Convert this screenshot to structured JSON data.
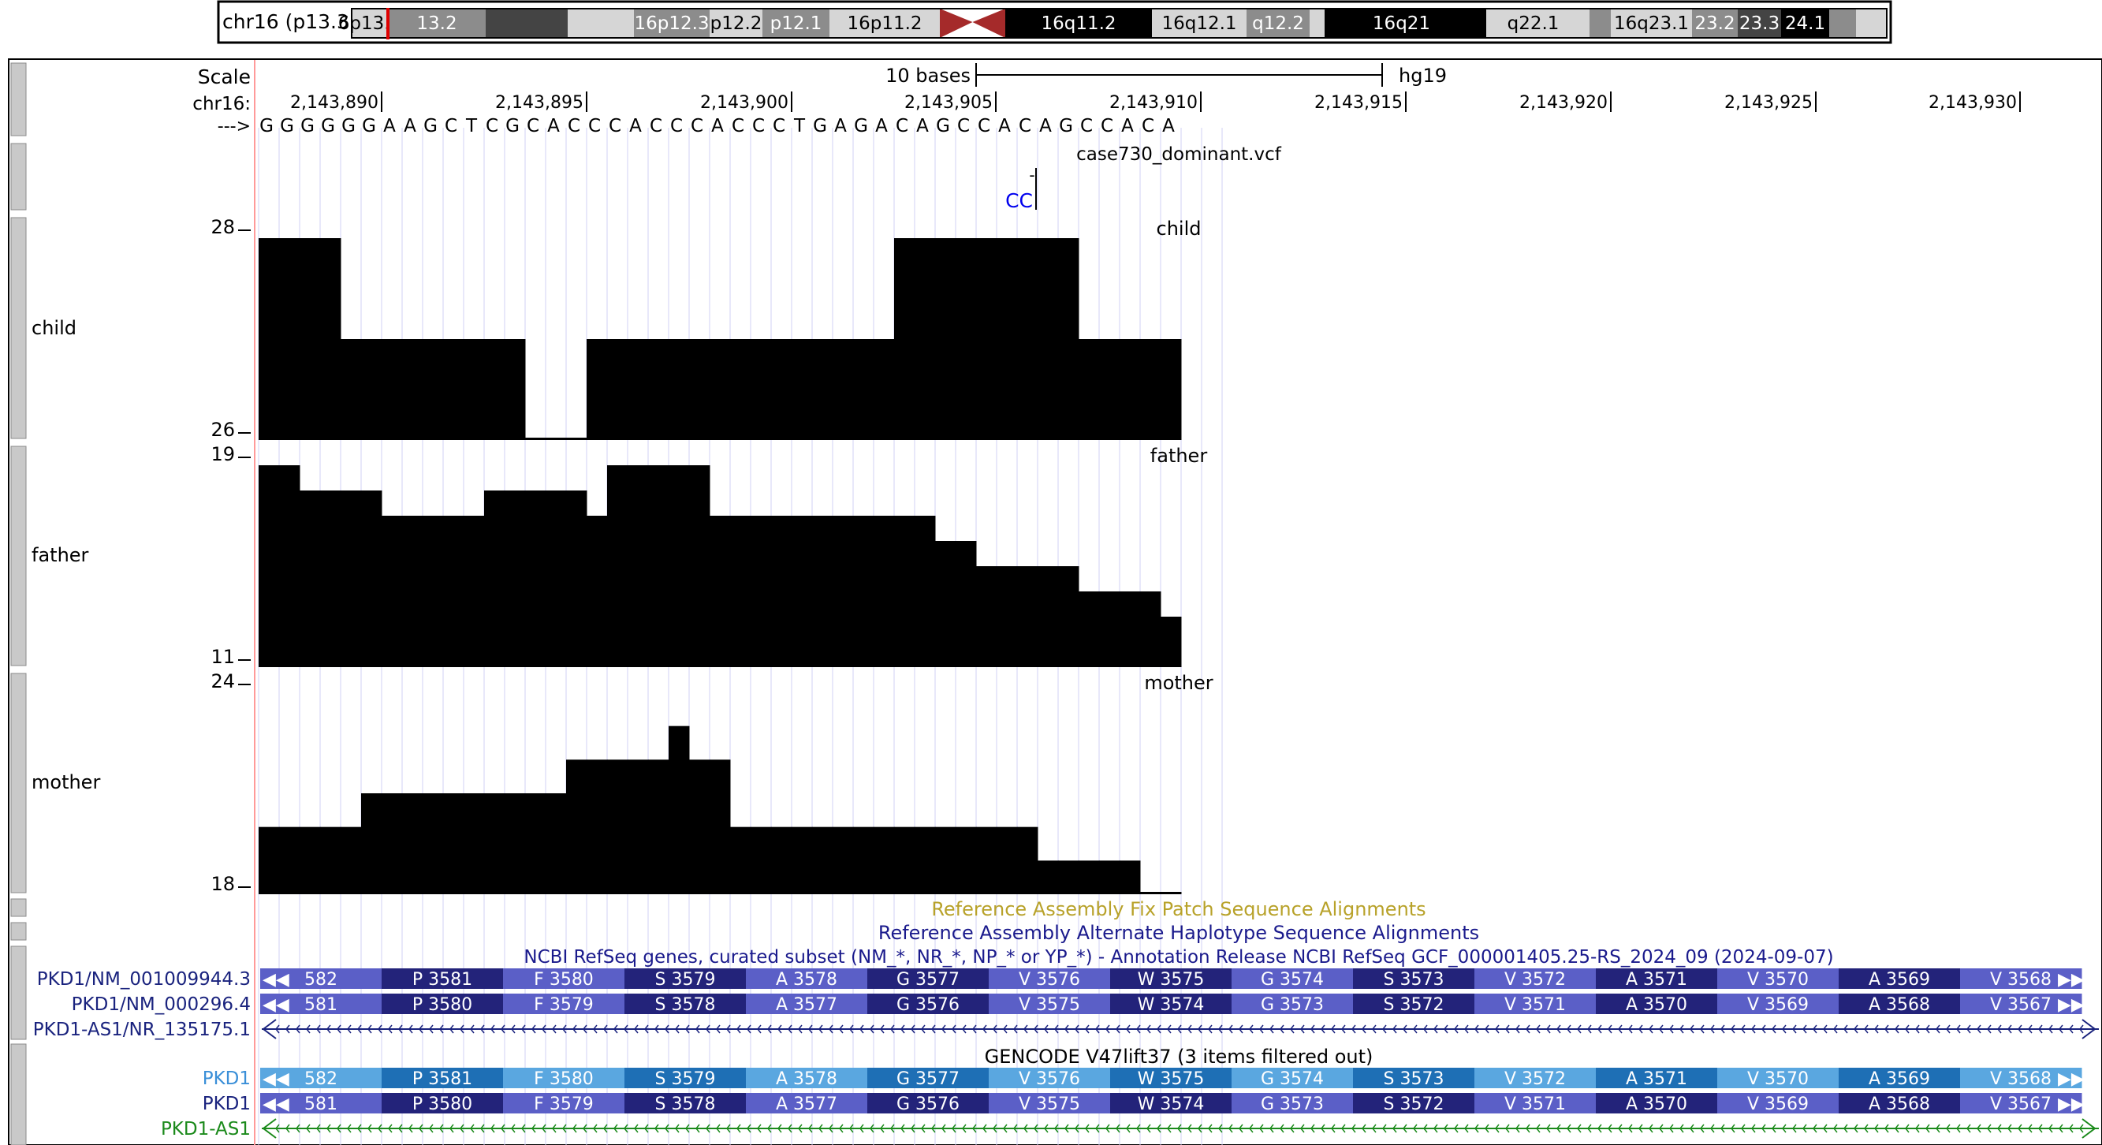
{
  "ideogram": {
    "label": "chr16 (p13.3)",
    "bands": [
      {
        "name": "6p13.3",
        "shade": "#d6d6d6",
        "text": "#000"
      },
      {
        "name": "13.2",
        "shade": "#8c8c8c",
        "text": "#fff"
      },
      {
        "name": "",
        "shade": "#444444",
        "text": "#fff"
      },
      {
        "name": "",
        "shade": "#d6d6d6",
        "text": "#000"
      },
      {
        "name": "16p12.3",
        "shade": "#8c8c8c",
        "text": "#fff"
      },
      {
        "name": "p12.2",
        "shade": "#d6d6d6",
        "text": "#000"
      },
      {
        "name": "p12.1",
        "shade": "#8c8c8c",
        "text": "#fff"
      },
      {
        "name": "16p11.2",
        "shade": "#d6d6d6",
        "text": "#000"
      },
      {
        "name": "",
        "shade": "centromere",
        "text": "#000"
      },
      {
        "name": "16q11.2",
        "shade": "#000000",
        "text": "#fff"
      },
      {
        "name": "16q12.1",
        "shade": "#d6d6d6",
        "text": "#000"
      },
      {
        "name": "q12.2",
        "shade": "#8c8c8c",
        "text": "#fff"
      },
      {
        "name": "",
        "shade": "#d6d6d6",
        "text": "#000"
      },
      {
        "name": "16q21",
        "shade": "#000000",
        "text": "#fff"
      },
      {
        "name": "",
        "shade": "#000000",
        "text": "#fff"
      },
      {
        "name": "q22.1",
        "shade": "#d6d6d6",
        "text": "#000"
      },
      {
        "name": "",
        "shade": "#d6d6d6",
        "text": "#000"
      },
      {
        "name": "",
        "shade": "#8c8c8c",
        "text": "#fff"
      },
      {
        "name": "16q23.1",
        "shade": "#d6d6d6",
        "text": "#000"
      },
      {
        "name": "23.2",
        "shade": "#8c8c8c",
        "text": "#fff"
      },
      {
        "name": "23.3",
        "shade": "#444444",
        "text": "#fff"
      },
      {
        "name": "24.1",
        "shade": "#000000",
        "text": "#fff"
      },
      {
        "name": "",
        "shade": "#8c8c8c",
        "text": "#fff"
      },
      {
        "name": "",
        "shade": "#d6d6d6",
        "text": "#000"
      }
    ]
  },
  "scale": {
    "label": "Scale",
    "bar": "10 bases",
    "assembly": "hg19"
  },
  "ruler": {
    "chrom": "chr16:",
    "positions": [
      "2,143,890",
      "2,143,895",
      "2,143,900",
      "2,143,905",
      "2,143,910",
      "2,143,915",
      "2,143,920",
      "2,143,925",
      "2,143,930"
    ]
  },
  "sequence": {
    "arrow": "--->",
    "bases": "GGGGGGAAGCTCGCACCCACCCACCCTGAGACAGCCACAGCCACA"
  },
  "vcf": {
    "title": "case730_dominant.vcf",
    "ref": "-",
    "alt": "CC"
  },
  "wiggles": [
    {
      "name": "child",
      "label": "child",
      "max": "28",
      "min": "26"
    },
    {
      "name": "father",
      "label": "father",
      "max": "19",
      "min": "11"
    },
    {
      "name": "mother",
      "label": "mother",
      "max": "24",
      "min": "18"
    }
  ],
  "coverage": {
    "child": [
      28,
      28,
      28,
      28,
      27,
      27,
      27,
      27,
      27,
      27,
      27,
      27,
      27,
      26,
      26,
      26,
      27,
      27,
      27,
      27,
      27,
      27,
      27,
      27,
      27,
      27,
      27,
      27,
      27,
      27,
      27,
      28,
      28,
      28,
      28,
      28,
      28,
      28,
      28,
      28,
      27,
      27,
      27,
      27,
      27
    ],
    "father": [
      19,
      19,
      18,
      18,
      18,
      18,
      17,
      17,
      17,
      17,
      17,
      18,
      18,
      18,
      18,
      18,
      17,
      19,
      19,
      19,
      19,
      19,
      17,
      17,
      17,
      17,
      17,
      17,
      17,
      17,
      17,
      17,
      17,
      16,
      16,
      15,
      15,
      15,
      15,
      15,
      14,
      14,
      14,
      14,
      13
    ],
    "mother": [
      20,
      20,
      20,
      20,
      20,
      21,
      21,
      21,
      21,
      21,
      21,
      21,
      21,
      21,
      21,
      22,
      22,
      22,
      22,
      22,
      23,
      22,
      22,
      20,
      20,
      20,
      20,
      20,
      20,
      20,
      20,
      20,
      20,
      20,
      20,
      20,
      20,
      20,
      19,
      19,
      19,
      19,
      19,
      18,
      18
    ]
  },
  "dense_titles": {
    "fix_patch": "Reference Assembly Fix Patch Sequence Alignments",
    "alt_haplo": "Reference Assembly Alternate Haplotype Sequence Alignments",
    "refseq": "NCBI RefSeq genes, curated subset (NM_*, NR_*, NP_* or YP_*) - Annotation Release NCBI RefSeq GCF_000001405.25-RS_2024_09 (2024-09-07)",
    "gencode": "GENCODE V47lift37 (3 items filtered out)"
  },
  "genes": [
    {
      "name": "refseq-pkd1-nm001009944",
      "label": "PKD1/NM_001009944.3",
      "color": "#1a237e",
      "type": "coding",
      "shade": "A",
      "cols": [
        "582",
        "P 3581",
        "F 3580",
        "S 3579",
        "A 3578",
        "G 3577",
        "V 3576",
        "W 3575",
        "G 3574",
        "S 3573",
        "V 3572",
        "A 3571",
        "V 3570",
        "A 3569",
        "V 3568"
      ]
    },
    {
      "name": "refseq-pkd1-nm000296",
      "label": "PKD1/NM_000296.4",
      "color": "#1a237e",
      "type": "coding",
      "shade": "A",
      "cols": [
        "581",
        "P 3580",
        "F 3579",
        "S 3578",
        "A 3577",
        "G 3576",
        "V 3575",
        "W 3574",
        "G 3573",
        "S 3572",
        "V 3571",
        "A 3570",
        "V 3569",
        "A 3568",
        "V 3567"
      ]
    },
    {
      "name": "refseq-pkd1as1",
      "label": "PKD1-AS1/NR_135175.1",
      "color": "#1a237e",
      "type": "noncoding",
      "stroke": "#1a237e"
    },
    {
      "name": "gencode-pkd1-a",
      "label": "PKD1",
      "color": "#3a8fd8",
      "type": "coding",
      "shade": "B",
      "cols": [
        "582",
        "P 3581",
        "F 3580",
        "S 3579",
        "A 3578",
        "G 3577",
        "V 3576",
        "W 3575",
        "G 3574",
        "S 3573",
        "V 3572",
        "A 3571",
        "V 3570",
        "A 3569",
        "V 3568"
      ]
    },
    {
      "name": "gencode-pkd1-b",
      "label": "PKD1",
      "color": "#1a237e",
      "type": "coding",
      "shade": "A",
      "cols": [
        "581",
        "P 3580",
        "F 3579",
        "S 3578",
        "A 3577",
        "G 3576",
        "V 3575",
        "W 3574",
        "G 3573",
        "S 3572",
        "V 3571",
        "A 3570",
        "V 3569",
        "A 3568",
        "V 3567"
      ]
    },
    {
      "name": "gencode-pkd1as1",
      "label": "PKD1-AS1",
      "color": "#1b8a1b",
      "type": "noncoding",
      "stroke": "#1b8a1b"
    }
  ],
  "colors": {
    "fix_patch": "#b8a22a",
    "dense_title": "#1a1a8c",
    "vcf_alt": "#0000ee",
    "gencode_title": "#000000",
    "shadeA_light": "#5b5fc7",
    "shadeA_dark": "#23237a",
    "shadeB_light": "#5aa7e0",
    "shadeB_dark": "#1e6fb5"
  }
}
